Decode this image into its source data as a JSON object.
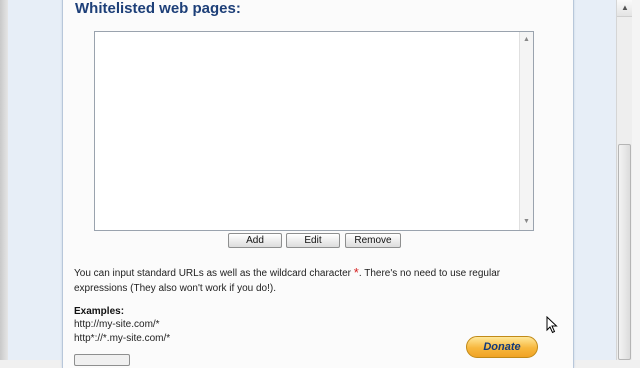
{
  "section": {
    "title": "Whitelisted web pages:"
  },
  "whitelist": {
    "items": []
  },
  "buttons": {
    "add": "Add",
    "edit": "Edit",
    "remove": "Remove",
    "donate": "Donate"
  },
  "info": {
    "text_before": "You can input standard URLs as well as the wildcard character ",
    "wildcard": "*",
    "text_after": ". There's no need to use regular expressions (They also won't work if you do!)."
  },
  "examples": {
    "title": "Examples:",
    "items": [
      "http://my-site.com/*",
      "http*://*.my-site.com/*"
    ]
  },
  "icons": {
    "listbox_up": "up-arrow-icon",
    "listbox_down": "down-arrow-icon",
    "cursor": "mouse-pointer-icon"
  },
  "colors": {
    "title": "#1d3f78",
    "wildcard": "#d62020",
    "donate_bg": "#f7b73d",
    "donate_text": "#123a7c"
  }
}
